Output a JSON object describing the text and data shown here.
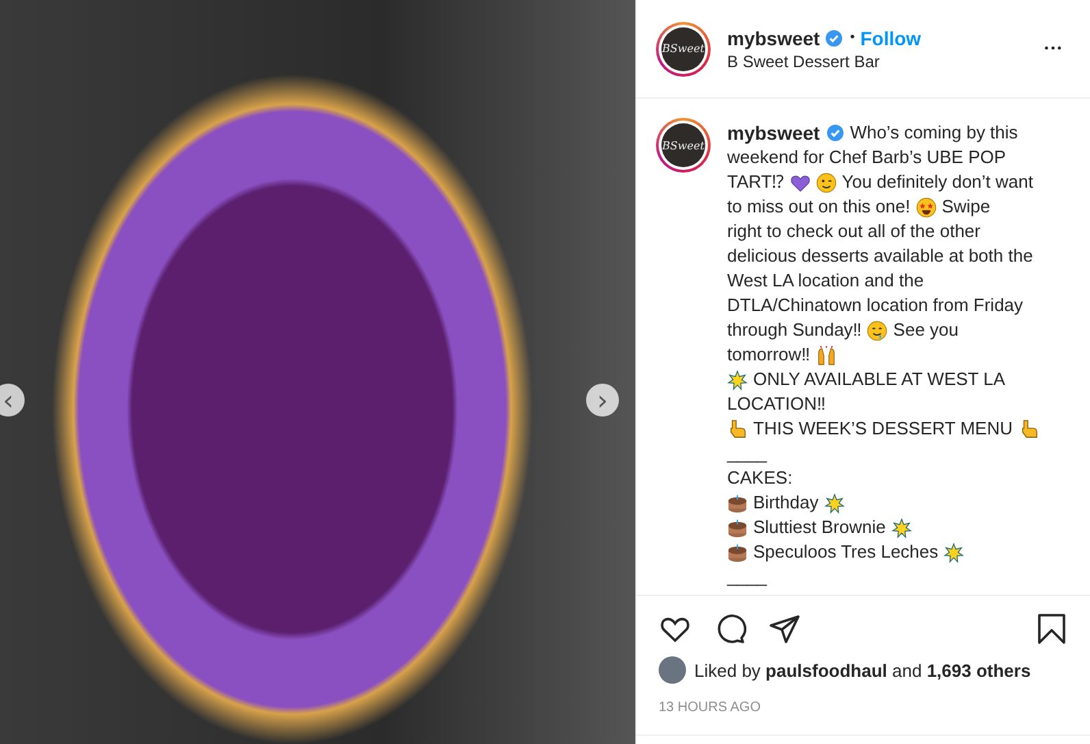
{
  "photo": {
    "prev_arrow": "‹",
    "next_arrow": "›"
  },
  "header": {
    "logo_text": "BSweet",
    "username": "mybsweet",
    "verified": true,
    "separator": "•",
    "follow": "Follow",
    "location": "B Sweet Dessert Bar",
    "more": "•••"
  },
  "caption": {
    "logo_text": "BSweet",
    "username": "mybsweet",
    "verified": true,
    "paragraphs": [
      [
        {
          "kind": "text",
          "text": "Who’s coming by this"
        }
      ],
      [
        {
          "kind": "text",
          "text": "weekend for Chef Barb’s UBE POP"
        }
      ],
      [
        {
          "kind": "text",
          "text": "TART⁉"
        },
        {
          "kind": "heart"
        },
        {
          "kind": "wink"
        },
        {
          "kind": "text",
          "text": "You definitely don’t want"
        }
      ],
      [
        {
          "kind": "text",
          "text": "to miss out on this one!"
        },
        {
          "kind": "star-eyes"
        },
        {
          "kind": "text",
          "text": "Swipe"
        }
      ],
      [
        {
          "kind": "text",
          "text": "right to check out all of the other"
        }
      ],
      [
        {
          "kind": "text",
          "text": "delicious desserts available at both the"
        }
      ],
      [
        {
          "kind": "text",
          "text": "West LA location and the"
        }
      ],
      [
        {
          "kind": "text",
          "text": "DTLA/Chinatown location from Friday"
        }
      ],
      [
        {
          "kind": "text",
          "text": "through Sunday‼"
        },
        {
          "kind": "smile"
        },
        {
          "kind": "text",
          "text": "See you"
        }
      ],
      [
        {
          "kind": "text",
          "text": "tomorrow‼"
        },
        {
          "kind": "hands"
        }
      ],
      [
        {
          "kind": "sparkle"
        },
        {
          "kind": "text",
          "text": "ONLY AVAILABLE AT WEST LA"
        }
      ],
      [
        {
          "kind": "text",
          "text": "LOCATION‼"
        }
      ],
      [
        {
          "kind": "point"
        },
        {
          "kind": "text",
          "text": "THIS WEEK’S DESSERT MENU"
        },
        {
          "kind": "point"
        }
      ],
      [
        {
          "kind": "text",
          "text": "____"
        }
      ],
      [
        {
          "kind": "text",
          "text": "CAKES:"
        }
      ],
      [
        {
          "kind": "cake"
        },
        {
          "kind": "text",
          "text": "Birthday"
        },
        {
          "kind": "sparkle"
        }
      ],
      [
        {
          "kind": "cake"
        },
        {
          "kind": "text",
          "text": "Sluttiest Brownie"
        },
        {
          "kind": "sparkle"
        }
      ],
      [
        {
          "kind": "cake"
        },
        {
          "kind": "text",
          "text": "Speculoos Tres Leches"
        },
        {
          "kind": "sparkle"
        }
      ],
      [
        {
          "kind": "text",
          "text": "____"
        }
      ]
    ]
  },
  "likes": {
    "text": "Liked by **paulsfoodhaul** and **1,693 others**"
  },
  "time": "13 HOURS AGO"
}
